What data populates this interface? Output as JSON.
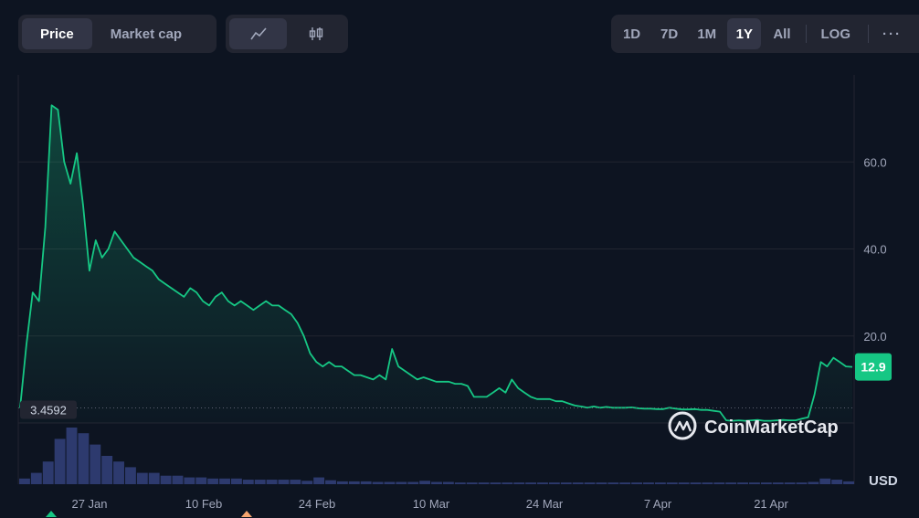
{
  "toolbar": {
    "type_tabs": [
      "Price",
      "Market cap"
    ],
    "active_type": "Price",
    "chart_style_icons": [
      "line-chart-icon",
      "candlestick-icon"
    ],
    "active_style": "line-chart-icon",
    "ranges": [
      "1D",
      "7D",
      "1M",
      "1Y",
      "All"
    ],
    "active_range": "1Y",
    "log_label": "LOG",
    "more_label": "···"
  },
  "watermark": {
    "text": "CoinMarketCap",
    "icon": "coinmarketcap-logo-icon"
  },
  "currency_label": "USD",
  "current_price_label": "12.9",
  "start_price_label": "3.4592",
  "colors": {
    "line": "#16c784",
    "current_badge": "#16c784",
    "background": "#0d1421",
    "volume": "#2d3a6e",
    "up_marker": "#16c784",
    "down_marker": "#f5a46e"
  },
  "chart_data": {
    "type": "line",
    "title": "",
    "xlabel": "",
    "ylabel": "USD",
    "x_tick_labels": [
      "27 Jan",
      "10 Feb",
      "24 Feb",
      "10 Mar",
      "24 Mar",
      "7 Apr",
      "21 Apr"
    ],
    "y_tick_labels": [
      "20.0",
      "40.0",
      "60.0"
    ],
    "ylim": [
      0,
      80
    ],
    "grid": true,
    "series": [
      {
        "values": [
          3.46,
          18,
          30,
          28,
          45,
          73,
          72,
          60,
          55,
          62,
          50,
          35,
          42,
          38,
          40,
          44,
          42,
          40,
          38,
          37,
          36,
          35,
          33,
          32,
          31,
          30,
          29,
          31,
          30,
          28,
          27,
          29,
          30,
          28,
          27,
          28,
          27,
          26,
          27,
          28,
          27,
          27,
          26,
          25,
          23,
          20,
          16,
          14,
          13,
          14,
          13,
          13,
          12,
          11,
          11,
          10.5,
          10,
          11,
          10,
          17,
          13,
          12,
          11,
          10,
          10.5,
          10,
          9.5,
          9.5,
          9.5,
          9,
          9,
          8.5,
          6,
          6,
          6,
          7,
          8,
          7,
          10,
          8,
          7,
          6,
          5.5,
          5.5,
          5.5,
          5,
          5,
          4.5,
          4,
          3.8,
          3.5,
          3.8,
          3.5,
          3.7,
          3.5,
          3.5,
          3.5,
          3.6,
          3.4,
          3.3,
          3.3,
          3.2,
          3.2,
          3.5,
          3.3,
          3.1,
          3.1,
          3.2,
          3.0,
          3.0,
          2.8,
          2.6,
          0.6,
          0.5,
          0.6,
          0.5,
          0.6,
          0.7,
          0.5,
          0.5,
          0.6,
          0.7,
          0.6,
          0.6,
          1.0,
          1.3,
          6.5,
          14,
          13,
          15,
          14,
          13,
          12.9
        ]
      }
    ],
    "volume": [
      1,
      2,
      4,
      8,
      10,
      9,
      7,
      5,
      4,
      3,
      2,
      2,
      1.5,
      1.5,
      1.2,
      1.2,
      1,
      1,
      1,
      0.8,
      0.8,
      0.8,
      0.8,
      0.8,
      0.6,
      1.2,
      0.7,
      0.5,
      0.5,
      0.5,
      0.4,
      0.4,
      0.4,
      0.4,
      0.6,
      0.4,
      0.4,
      0.3,
      0.3,
      0.3,
      0.3,
      0.3,
      0.3,
      0.3,
      0.3,
      0.3,
      0.3,
      0.3,
      0.3,
      0.3,
      0.3,
      0.3,
      0.3,
      0.3,
      0.3,
      0.3,
      0.3,
      0.3,
      0.3,
      0.3,
      0.3,
      0.3,
      0.3,
      0.3,
      0.3,
      0.3,
      0.3,
      0.4,
      1,
      0.8,
      0.5
    ]
  }
}
